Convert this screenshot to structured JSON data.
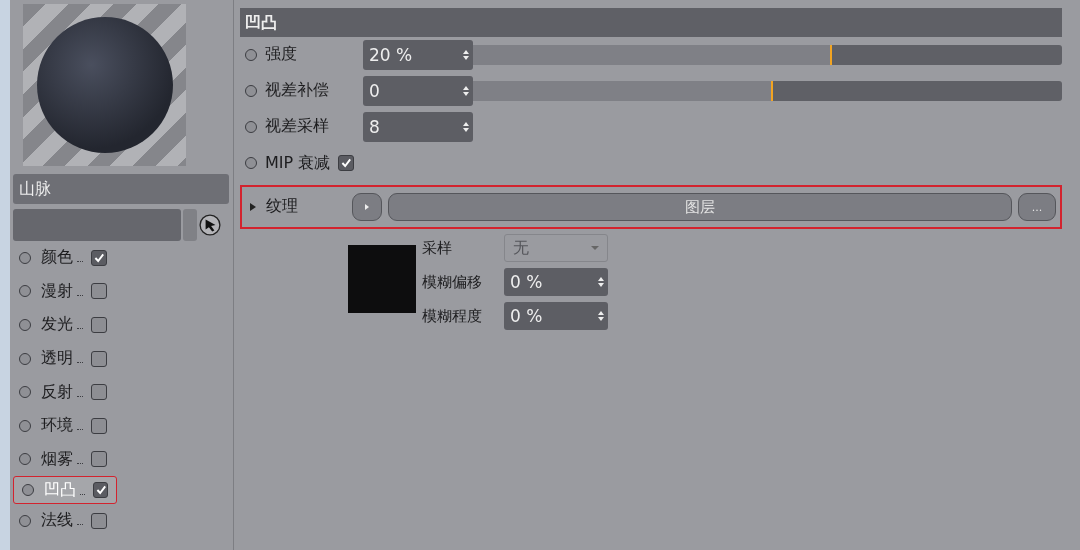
{
  "material": {
    "name": "山脉"
  },
  "channels": [
    {
      "label": "颜色",
      "checked": true,
      "selected": false
    },
    {
      "label": "漫射",
      "checked": false,
      "selected": false
    },
    {
      "label": "发光",
      "checked": false,
      "selected": false
    },
    {
      "label": "透明",
      "checked": false,
      "selected": false
    },
    {
      "label": "反射",
      "checked": false,
      "selected": false
    },
    {
      "label": "环境",
      "checked": false,
      "selected": false
    },
    {
      "label": "烟雾",
      "checked": false,
      "selected": false
    },
    {
      "label": "凹凸",
      "checked": true,
      "selected": true
    },
    {
      "label": "法线",
      "checked": false,
      "selected": false
    }
  ],
  "section": {
    "title": "凹凸"
  },
  "params": [
    {
      "kind": "slider",
      "label": "强度",
      "value": "20 %",
      "level": 0.61
    },
    {
      "kind": "slider",
      "label": "视差补偿",
      "value": "0",
      "level": 0.51
    },
    {
      "kind": "number",
      "label": "视差采样",
      "value": "8"
    },
    {
      "kind": "checkbox",
      "label": "MIP 衰减",
      "checked": true
    }
  ],
  "texture": {
    "label": "纹理",
    "highlighted": true,
    "button": "图层",
    "more": "...",
    "sampling": {
      "label": "采样",
      "value": "无",
      "disabled": true
    },
    "fields": [
      {
        "label": "模糊偏移",
        "value": "0 %"
      },
      {
        "label": "模糊程度",
        "value": "0 %"
      }
    ]
  }
}
